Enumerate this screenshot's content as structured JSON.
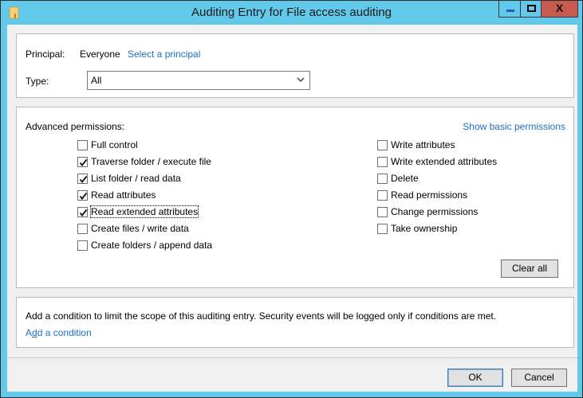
{
  "window": {
    "title": "Auditing Entry for File access auditing",
    "icon": "folder-icon",
    "controls": {
      "minimize": "minimize-icon",
      "maximize": "maximize-icon",
      "close": "close-icon",
      "close_glyph": "X"
    }
  },
  "principal": {
    "label": "Principal:",
    "value": "Everyone",
    "select_link": "Select a principal"
  },
  "type": {
    "label": "Type:",
    "selected": "All"
  },
  "permissions": {
    "heading": "Advanced permissions:",
    "toggle_link": "Show basic permissions",
    "left": [
      {
        "label": "Full control",
        "checked": false
      },
      {
        "label": "Traverse folder / execute file",
        "checked": true
      },
      {
        "label": "List folder / read data",
        "checked": true
      },
      {
        "label": "Read attributes",
        "checked": true
      },
      {
        "label": "Read extended attributes",
        "checked": true,
        "focused": true
      },
      {
        "label": "Create files / write data",
        "checked": false
      },
      {
        "label": "Create folders / append data",
        "checked": false
      }
    ],
    "right": [
      {
        "label": "Write attributes",
        "checked": false
      },
      {
        "label": "Write extended attributes",
        "checked": false
      },
      {
        "label": "Delete",
        "checked": false
      },
      {
        "label": "Read permissions",
        "checked": false
      },
      {
        "label": "Change permissions",
        "checked": false
      },
      {
        "label": "Take ownership",
        "checked": false
      }
    ],
    "clear_all": "Clear all"
  },
  "condition": {
    "description": "Add a condition to limit the scope of this auditing entry. Security events will be logged only if conditions are met.",
    "link_prefix": "A",
    "link_accel": "d",
    "link_rest": "d a condition"
  },
  "footer": {
    "ok": "OK",
    "cancel": "Cancel"
  },
  "colors": {
    "titlebar": "#62c9ea",
    "close_button": "#c75b50",
    "link": "#1e6fc4"
  }
}
